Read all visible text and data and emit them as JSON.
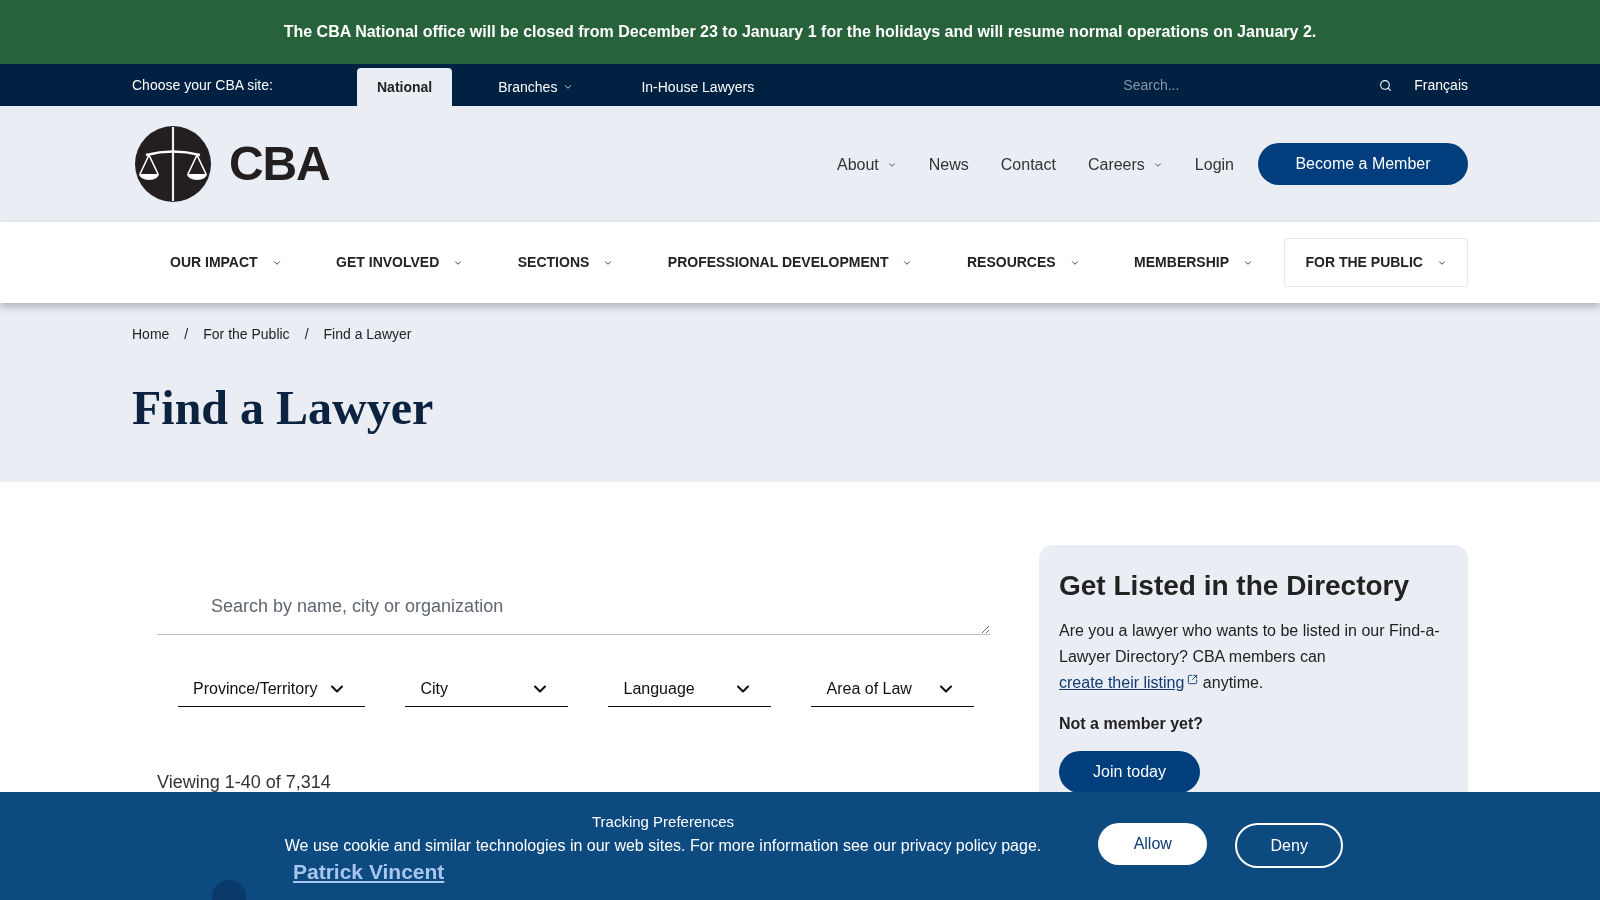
{
  "alert": {
    "text": "The CBA National office will be closed from December 23 to January 1 for the holidays and will resume normal operations on January 2."
  },
  "site_bar": {
    "label": "Choose your CBA site:",
    "sites": [
      {
        "label": "National",
        "selected": true,
        "has_menu": false
      },
      {
        "label": "Branches",
        "selected": false,
        "has_menu": true
      },
      {
        "label": "In-House Lawyers",
        "selected": false,
        "has_menu": false
      }
    ],
    "search": {
      "placeholder": "Search..."
    },
    "language_link": "Français"
  },
  "header": {
    "logo_text": "CBA",
    "nav": [
      {
        "label": "About",
        "has_menu": true
      },
      {
        "label": "News",
        "has_menu": false
      },
      {
        "label": "Contact",
        "has_menu": false
      },
      {
        "label": "Careers",
        "has_menu": true
      },
      {
        "label": "Login",
        "has_menu": false
      }
    ],
    "cta_button": "Become a Member"
  },
  "main_nav": [
    {
      "label": "OUR IMPACT",
      "selected": false
    },
    {
      "label": "GET INVOLVED",
      "selected": false
    },
    {
      "label": "SECTIONS",
      "selected": false
    },
    {
      "label": "PROFESSIONAL DEVELOPMENT",
      "selected": false
    },
    {
      "label": "RESOURCES",
      "selected": false
    },
    {
      "label": "MEMBERSHIP",
      "selected": false
    },
    {
      "label": "FOR THE PUBLIC",
      "selected": true
    }
  ],
  "breadcrumb": [
    {
      "text": "Home",
      "separator": "/"
    },
    {
      "text": "For the Public",
      "separator": "/"
    },
    {
      "text": "Find a Lawyer"
    }
  ],
  "page_title": "Find a Lawyer",
  "search": {
    "placeholder": "Search by name, city or organization"
  },
  "filters": [
    {
      "label": "Province/Territory"
    },
    {
      "label": "City"
    },
    {
      "label": "Language"
    },
    {
      "label": "Area of Law"
    }
  ],
  "results": {
    "summary": "Viewing 1-40 of 7,314",
    "items": [
      {
        "name": "Patrick Vincent"
      }
    ]
  },
  "directory_card": {
    "title": "Get Listed in the Directory",
    "text_before": "Are you a lawyer who wants to be listed in our Find-a-Lawyer Directory? CBA members can ",
    "link": "create their listing",
    "text_after": " anytime.",
    "subtitle": "Not a member yet?",
    "button": "Join today"
  },
  "cookie_banner": {
    "title": "Tracking Preferences",
    "text": "We use cookie and similar technologies in our web sites. For more information see our privacy policy page.",
    "buttons": [
      {
        "label": "Allow",
        "kind": "filled"
      },
      {
        "label": "Deny",
        "kind": "outline"
      }
    ]
  }
}
